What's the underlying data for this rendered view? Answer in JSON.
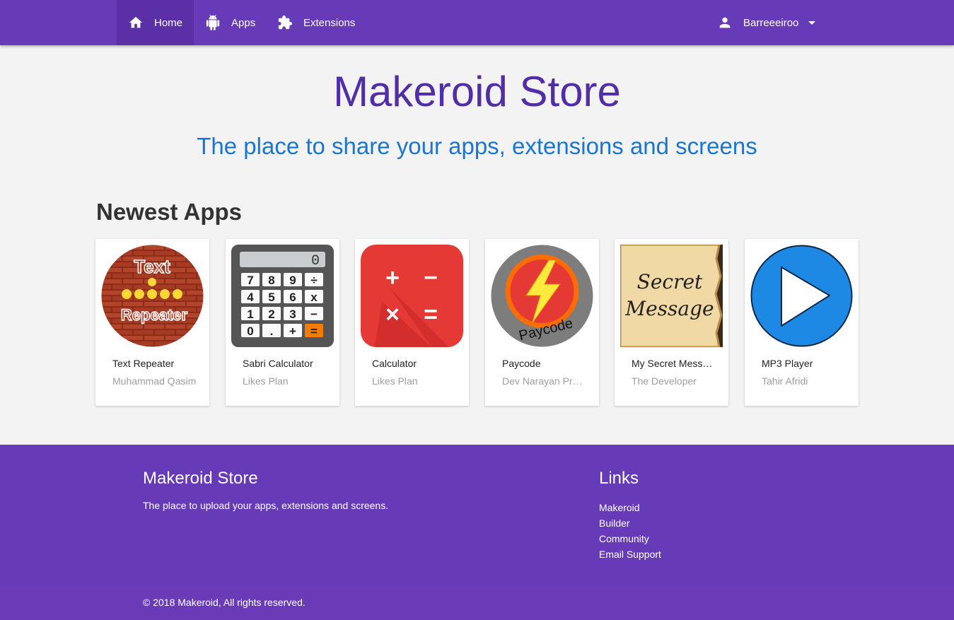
{
  "nav": {
    "home": {
      "label": "Home",
      "icon": "home-icon"
    },
    "apps": {
      "label": "Apps",
      "icon": "android-icon"
    },
    "extensions": {
      "label": "Extensions",
      "icon": "puzzle-icon"
    },
    "user": {
      "label": "Barreeeiroo",
      "icon": "person-icon"
    }
  },
  "hero": {
    "title": "Makeroid Store",
    "subtitle": "The place to share your apps, extensions and screens"
  },
  "newest_apps": {
    "title": "Newest Apps",
    "items": [
      {
        "name": "Text Repeater",
        "author": "Muhammad Qasim"
      },
      {
        "name": "Sabri Calculator",
        "author": "Likes Plan"
      },
      {
        "name": "Calculator",
        "author": "Likes Plan"
      },
      {
        "name": "Paycode",
        "author": "Dev Narayan Prasad"
      },
      {
        "name": "My Secret Message",
        "author": "The Developer"
      },
      {
        "name": "MP3 Player",
        "author": "Tahir Afridi"
      }
    ],
    "thumb_text": {
      "text_repeater_top": "Text",
      "text_repeater_bottom": "Repeater",
      "calc_display": "0",
      "calc_keys": [
        "7",
        "8",
        "9",
        "÷",
        "4",
        "5",
        "6",
        "x",
        "1",
        "2",
        "3",
        "−",
        "0",
        ".",
        "+",
        "="
      ],
      "calc2_symbols": [
        "+",
        "−",
        "×",
        "="
      ],
      "paycode": "Paycode",
      "secret_line1": "Secret",
      "secret_line2": "Message"
    }
  },
  "footer": {
    "title": "Makeroid Store",
    "description": "The place to upload your apps, extensions and screens.",
    "links_title": "Links",
    "links": [
      "Makeroid",
      "Builder",
      "Community",
      "Email Support"
    ],
    "copyright": "© 2018 Makeroid, All rights reserved."
  },
  "colors": {
    "primary": "#673ab7",
    "title": "#512da8",
    "subtitle": "#1976d2"
  }
}
